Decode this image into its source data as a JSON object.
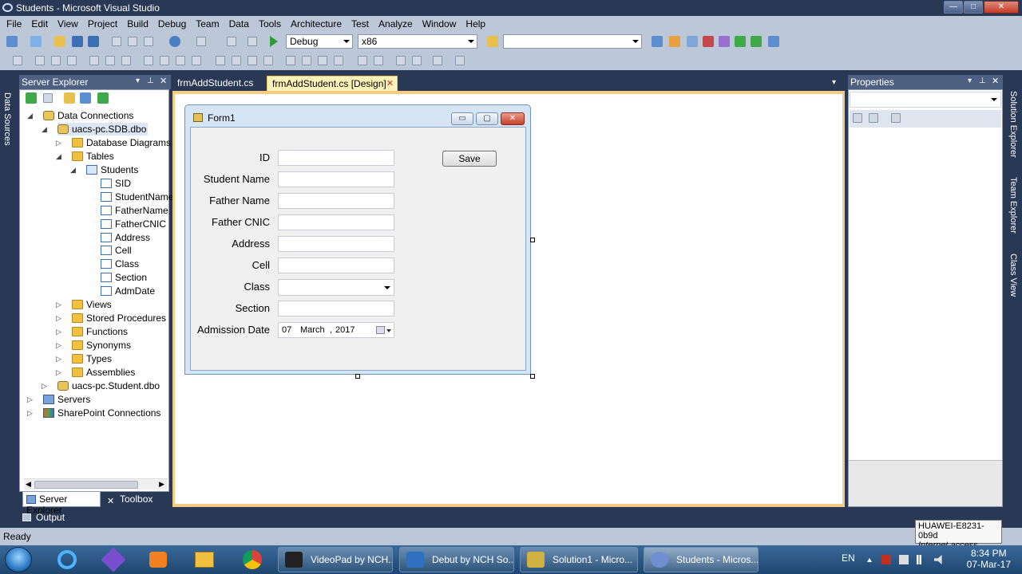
{
  "window": {
    "title": "Students - Microsoft Visual Studio",
    "controls": {
      "minimize": "—",
      "maximize": "□",
      "close": "✕"
    }
  },
  "menu": [
    "File",
    "Edit",
    "View",
    "Project",
    "Build",
    "Debug",
    "Team",
    "Data",
    "Tools",
    "Architecture",
    "Test",
    "Analyze",
    "Window",
    "Help"
  ],
  "toolbar": {
    "config": "Debug",
    "platform": "x86",
    "find": ""
  },
  "side_left": {
    "tab": "Data Sources"
  },
  "side_right": {
    "tabs": [
      "Solution Explorer",
      "Team Explorer",
      "Class View"
    ]
  },
  "server_explorer": {
    "title": "Server Explorer",
    "header_buttons": [
      "▾",
      "⊥",
      "✕"
    ],
    "tree": [
      {
        "label": "Data Connections",
        "icon": "db"
      },
      {
        "label": "uacs-pc.SDB.dbo",
        "icon": "db"
      },
      {
        "label": "Database Diagrams",
        "icon": "folder"
      },
      {
        "label": "Tables",
        "icon": "folder"
      },
      {
        "label": "Students",
        "icon": "table"
      },
      {
        "label": "SID",
        "icon": "column"
      },
      {
        "label": "StudentName",
        "icon": "column"
      },
      {
        "label": "FatherName",
        "icon": "column"
      },
      {
        "label": "FatherCNIC",
        "icon": "column"
      },
      {
        "label": "Address",
        "icon": "column"
      },
      {
        "label": "Cell",
        "icon": "column"
      },
      {
        "label": "Class",
        "icon": "column"
      },
      {
        "label": "Section",
        "icon": "column"
      },
      {
        "label": "AdmDate",
        "icon": "column"
      },
      {
        "label": "Views",
        "icon": "folder"
      },
      {
        "label": "Stored Procedures",
        "icon": "folder"
      },
      {
        "label": "Functions",
        "icon": "folder"
      },
      {
        "label": "Synonyms",
        "icon": "folder"
      },
      {
        "label": "Types",
        "icon": "folder"
      },
      {
        "label": "Assemblies",
        "icon": "folder"
      },
      {
        "label": "uacs-pc.Student.dbo",
        "icon": "db"
      },
      {
        "label": "Servers",
        "icon": "server"
      },
      {
        "label": "SharePoint Connections",
        "icon": "sharepoint"
      }
    ],
    "bottom_tabs": [
      "Server Explorer",
      "Toolbox"
    ]
  },
  "doc_tabs": [
    {
      "label": "frmAddStudent.cs",
      "active": false
    },
    {
      "label": "frmAddStudent.cs [Design]",
      "active": true
    }
  ],
  "doc_tab_close": "✕",
  "doc_tab_dropdown": "▾",
  "form": {
    "title": "Form1",
    "caption_buttons": {
      "minimize": "▭",
      "maximize": "▢",
      "close": "✕"
    },
    "labels": [
      "ID",
      "Student Name",
      "Father Name",
      "Father CNIC",
      "Address",
      "Cell",
      "Class",
      "Section",
      "Admission Date"
    ],
    "date": {
      "day": "07",
      "month": "March",
      "sep": ",",
      "year": "2017"
    },
    "save_button": "Save"
  },
  "properties": {
    "title": "Properties",
    "header_buttons": [
      "▾",
      "⊥",
      "✕"
    ]
  },
  "output_tab": "Output",
  "status": "Ready",
  "wifi_tooltip": {
    "name": "HUAWEI-E8231-0b9d",
    "status": "Internet access"
  },
  "taskbar": {
    "buttons": [
      {
        "label": "VideoPad by NCH...",
        "active": false
      },
      {
        "label": "Debut by NCH So...",
        "active": false
      },
      {
        "label": "Solution1 - Micro...",
        "active": false
      },
      {
        "label": "Students - Micros...",
        "active": true
      }
    ],
    "lang": "EN",
    "time": "8:34 PM",
    "date": "07-Mar-17"
  },
  "colors": {
    "vs_frame": "#293955",
    "chrome": "#bcc7d8",
    "designer_border": "#f5cc84",
    "panel_header": "#4d6082"
  }
}
